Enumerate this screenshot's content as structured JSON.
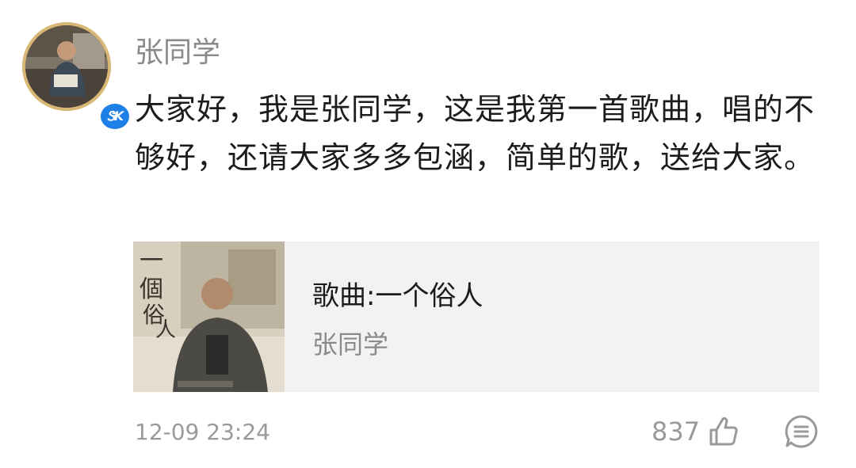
{
  "post": {
    "username": "张同学",
    "badge_text": "ᏕK",
    "avatar_icon": "user-avatar-photo",
    "content": "大家好，我是张同学，这是我第一首歌曲，唱的不够好，还请大家多多包涵，简单的歌，送给大家。",
    "song": {
      "title": "歌曲:一个俗人",
      "artist": "张同学",
      "cover_icon": "album-cover-image",
      "cover_text": "一個俗人"
    },
    "timestamp": "12-09 23:24",
    "like_count": "837",
    "like_icon": "thumbs-up-icon",
    "comment_icon": "comment-icon"
  },
  "colors": {
    "username": "#8a8a8a",
    "text": "#1c1c1c",
    "meta": "#9a9a9a",
    "card_bg": "#f2f2f2",
    "badge": "#1e7fe6",
    "avatar_ring": "#d9b775"
  }
}
